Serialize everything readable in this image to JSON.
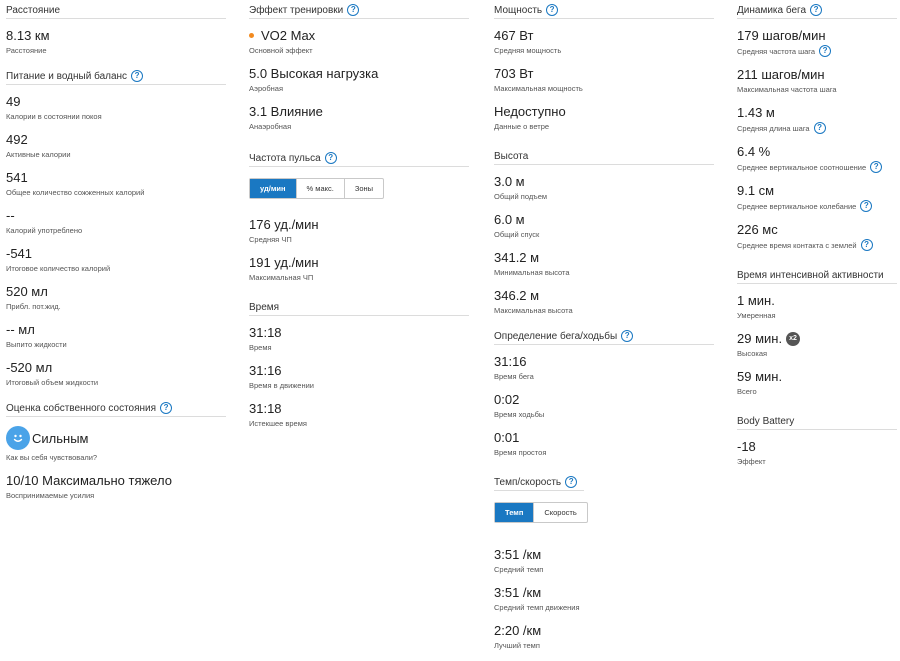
{
  "col1": {
    "distance": {
      "title": "Расстояние",
      "items": [
        {
          "value": "8.13 км",
          "label": "Расстояние"
        }
      ]
    },
    "nutrition": {
      "title": "Питание и водный баланс",
      "items": [
        {
          "value": "49",
          "label": "Калории в состоянии покоя"
        },
        {
          "value": "492",
          "label": "Активные калории"
        },
        {
          "value": "541",
          "label": "Общее количество сожженных калорий"
        },
        {
          "value": "--",
          "label": "Калорий употреблено"
        },
        {
          "value": "-541",
          "label": "Итоговое количество калорий"
        },
        {
          "value": "520 мл",
          "label": "Прибл. пот.жид."
        },
        {
          "value": "-- мл",
          "label": "Выпито жидкости"
        },
        {
          "value": "-520 мл",
          "label": "Итоговый объем жидкости"
        }
      ]
    },
    "self": {
      "title": "Оценка собственного состояния",
      "feel_value": "Сильным",
      "feel_label": "Как вы себя чувствовали?",
      "effort_value": "10/10 Максимально тяжело",
      "effort_label": "Воспринимаемые усилия"
    }
  },
  "col2": {
    "effect": {
      "title": "Эффект тренировки",
      "items": [
        {
          "value": "VO2 Max",
          "label": "Основной эффект"
        },
        {
          "value": "5.0 Высокая нагрузка",
          "label": "Аэробная"
        },
        {
          "value": "3.1 Влияние",
          "label": "Анаэробная"
        }
      ]
    },
    "hr": {
      "title": "Частота пульса",
      "tabs": [
        "уд/мин",
        "% макс.",
        "Зоны"
      ],
      "items": [
        {
          "value": "176 уд./мин",
          "label": "Средняя ЧП"
        },
        {
          "value": "191 уд./мин",
          "label": "Максимальная ЧП"
        }
      ]
    },
    "time": {
      "title": "Время",
      "items": [
        {
          "value": "31:18",
          "label": "Время"
        },
        {
          "value": "31:16",
          "label": "Время в движении"
        },
        {
          "value": "31:18",
          "label": "Истекшее время"
        }
      ]
    }
  },
  "col3": {
    "power": {
      "title": "Мощность",
      "items": [
        {
          "value": "467 Вт",
          "label": "Средняя мощность"
        },
        {
          "value": "703 Вт",
          "label": "Максимальная мощность"
        },
        {
          "value": "Недоступно",
          "label": "Данные о ветре"
        }
      ]
    },
    "elev": {
      "title": "Высота",
      "items": [
        {
          "value": "3.0 м",
          "label": "Общий подъем"
        },
        {
          "value": "6.0 м",
          "label": "Общий спуск"
        },
        {
          "value": "341.2 м",
          "label": "Минимальная высота"
        },
        {
          "value": "346.2 м",
          "label": "Максимальная высота"
        }
      ]
    },
    "runwalk": {
      "title": "Определение бега/ходьбы",
      "items": [
        {
          "value": "31:16",
          "label": "Время бега"
        },
        {
          "value": "0:02",
          "label": "Время ходьбы"
        },
        {
          "value": "0:01",
          "label": "Время простоя"
        }
      ]
    },
    "pace": {
      "title": "Темп/скорость",
      "tabs": [
        "Темп",
        "Скорость"
      ],
      "items": [
        {
          "value": "3:51 /км",
          "label": "Средний темп"
        },
        {
          "value": "3:51 /км",
          "label": "Средний темп движения"
        },
        {
          "value": "2:20 /км",
          "label": "Лучший темп"
        }
      ]
    }
  },
  "col4": {
    "dyn": {
      "title": "Динамика бега",
      "items": [
        {
          "value": "179 шагов/мин",
          "label": "Средняя частота шага"
        },
        {
          "value": "211 шагов/мин",
          "label": "Максимальная частота шага"
        },
        {
          "value": "1.43 м",
          "label": "Средняя длина шага"
        },
        {
          "value": "6.4 %",
          "label": "Среднее вертикальное соотношение"
        },
        {
          "value": "9.1 см",
          "label": "Среднее вертикальное колебание"
        },
        {
          "value": "226 мс",
          "label": "Среднее время контакта с землей"
        }
      ]
    },
    "intense": {
      "title": "Время интенсивной активности",
      "items": [
        {
          "value": "1 мин.",
          "label": "Умеренная"
        },
        {
          "value": "29 мин.",
          "label": "Высокая",
          "badge": "x2"
        },
        {
          "value": "59 мин.",
          "label": "Всего"
        }
      ]
    },
    "battery": {
      "title": "Body Battery",
      "items": [
        {
          "value": "-18",
          "label": "Эффект"
        }
      ]
    }
  },
  "icons": {
    "help": "question-circle-icon",
    "smile": "smiley-face-icon",
    "dot": "orange-dot-icon"
  },
  "colors": {
    "accent": "#1a78c2",
    "dot": "#f28a1f",
    "smile": "#4aa3e8"
  }
}
